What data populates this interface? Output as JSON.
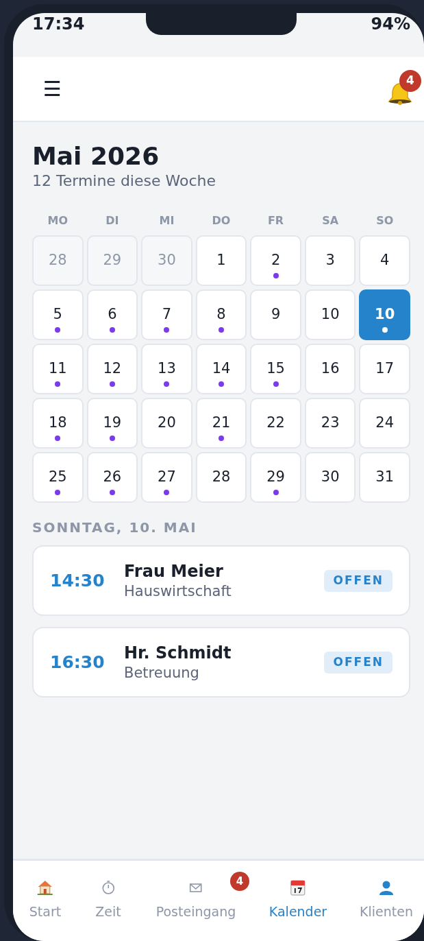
{
  "status_bar": {
    "time": "17:34",
    "battery": "94%"
  },
  "header": {
    "menu_icon": "☰",
    "notifications_badge": "4"
  },
  "month": {
    "title": "Mai 2026",
    "subtitle": "12 Termine diese Woche"
  },
  "weekdays": [
    "MO",
    "DI",
    "MI",
    "DO",
    "FR",
    "SA",
    "SO"
  ],
  "days": [
    {
      "label": "28",
      "outside": true,
      "has_events": false,
      "selected": false
    },
    {
      "label": "29",
      "outside": true,
      "has_events": false,
      "selected": false
    },
    {
      "label": "30",
      "outside": true,
      "has_events": false,
      "selected": false
    },
    {
      "label": "1",
      "outside": false,
      "has_events": false,
      "selected": false
    },
    {
      "label": "2",
      "outside": false,
      "has_events": true,
      "selected": false
    },
    {
      "label": "3",
      "outside": false,
      "has_events": false,
      "selected": false
    },
    {
      "label": "4",
      "outside": false,
      "has_events": false,
      "selected": false
    },
    {
      "label": "5",
      "outside": false,
      "has_events": true,
      "selected": false
    },
    {
      "label": "6",
      "outside": false,
      "has_events": true,
      "selected": false
    },
    {
      "label": "7",
      "outside": false,
      "has_events": true,
      "selected": false
    },
    {
      "label": "8",
      "outside": false,
      "has_events": true,
      "selected": false
    },
    {
      "label": "9",
      "outside": false,
      "has_events": false,
      "selected": false
    },
    {
      "label": "10",
      "outside": false,
      "has_events": false,
      "selected": false
    },
    {
      "label": "10",
      "outside": false,
      "has_events": true,
      "selected": true
    },
    {
      "label": "11",
      "outside": false,
      "has_events": true,
      "selected": false
    },
    {
      "label": "12",
      "outside": false,
      "has_events": true,
      "selected": false
    },
    {
      "label": "13",
      "outside": false,
      "has_events": true,
      "selected": false
    },
    {
      "label": "14",
      "outside": false,
      "has_events": true,
      "selected": false
    },
    {
      "label": "15",
      "outside": false,
      "has_events": true,
      "selected": false
    },
    {
      "label": "16",
      "outside": false,
      "has_events": false,
      "selected": false
    },
    {
      "label": "17",
      "outside": false,
      "has_events": false,
      "selected": false
    },
    {
      "label": "18",
      "outside": false,
      "has_events": true,
      "selected": false
    },
    {
      "label": "19",
      "outside": false,
      "has_events": true,
      "selected": false
    },
    {
      "label": "20",
      "outside": false,
      "has_events": false,
      "selected": false
    },
    {
      "label": "21",
      "outside": false,
      "has_events": true,
      "selected": false
    },
    {
      "label": "22",
      "outside": false,
      "has_events": false,
      "selected": false
    },
    {
      "label": "23",
      "outside": false,
      "has_events": false,
      "selected": false
    },
    {
      "label": "24",
      "outside": false,
      "has_events": false,
      "selected": false
    },
    {
      "label": "25",
      "outside": false,
      "has_events": true,
      "selected": false
    },
    {
      "label": "26",
      "outside": false,
      "has_events": true,
      "selected": false
    },
    {
      "label": "27",
      "outside": false,
      "has_events": true,
      "selected": false
    },
    {
      "label": "28",
      "outside": false,
      "has_events": false,
      "selected": false
    },
    {
      "label": "29",
      "outside": false,
      "has_events": true,
      "selected": false
    },
    {
      "label": "30",
      "outside": false,
      "has_events": false,
      "selected": false
    },
    {
      "label": "31",
      "outside": false,
      "has_events": false,
      "selected": false
    }
  ],
  "day_heading": "SONNTAG, 10. MAI",
  "appointments": [
    {
      "time": "14:30",
      "name": "Frau Meier",
      "service": "Hauswirtschaft",
      "status": "OFFEN"
    },
    {
      "time": "16:30",
      "name": "Hr. Schmidt",
      "service": "Betreuung",
      "status": "OFFEN"
    }
  ],
  "nav": [
    {
      "kind": "home",
      "label": "Start",
      "selected": false
    },
    {
      "kind": "timer",
      "label": "Zeit",
      "selected": false
    },
    {
      "kind": "mail",
      "label": "Posteingang",
      "selected": false,
      "badge": "4"
    },
    {
      "kind": "calendar",
      "label": "Kalender",
      "selected": true
    },
    {
      "kind": "person",
      "label": "Klienten",
      "selected": false
    }
  ]
}
